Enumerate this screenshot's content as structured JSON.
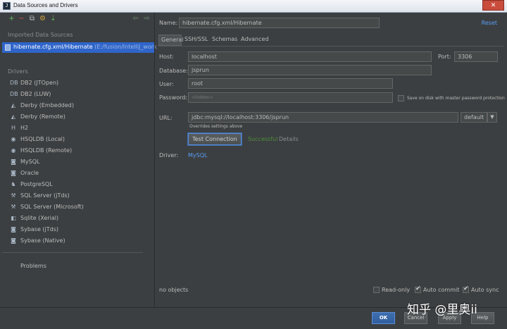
{
  "window": {
    "title": "Data Sources and Drivers",
    "app_icon": "J"
  },
  "left": {
    "toolbar": {
      "add": "+",
      "remove": "−",
      "copy": "⧉",
      "config": "⚙",
      "import": "⇣",
      "back": "⇦",
      "forward": "⇨"
    },
    "imported_header": "Imported Data Sources",
    "selected_source": {
      "name": "hibernate.cfg.xml/Hibernate",
      "path": "(E:/fusion/IntelliJ_work"
    },
    "drivers_header": "Drivers",
    "drivers": [
      {
        "name": "DB2 (JTOpen)",
        "icon": "db2-icon",
        "glyph": "DB"
      },
      {
        "name": "DB2 (LUW)",
        "icon": "db2-icon",
        "glyph": "DB"
      },
      {
        "name": "Derby (Embedded)",
        "icon": "derby-icon",
        "glyph": "◭"
      },
      {
        "name": "Derby (Remote)",
        "icon": "derby-icon",
        "glyph": "◭"
      },
      {
        "name": "H2",
        "icon": "h2-icon",
        "glyph": "H"
      },
      {
        "name": "HSQLDB (Local)",
        "icon": "hsqldb-icon",
        "glyph": "◉"
      },
      {
        "name": "HSQLDB (Remote)",
        "icon": "hsqldb-icon",
        "glyph": "◉"
      },
      {
        "name": "MySQL",
        "icon": "mysql-icon",
        "glyph": "◙"
      },
      {
        "name": "Oracle",
        "icon": "oracle-icon",
        "glyph": "◙"
      },
      {
        "name": "PostgreSQL",
        "icon": "postgresql-icon",
        "glyph": "♞"
      },
      {
        "name": "SQL Server (jTds)",
        "icon": "sqlserver-icon",
        "glyph": "⚒"
      },
      {
        "name": "SQL Server (Microsoft)",
        "icon": "sqlserver-icon",
        "glyph": "⚒"
      },
      {
        "name": "Sqlite (Xerial)",
        "icon": "sqlite-icon",
        "glyph": "◧"
      },
      {
        "name": "Sybase (jTds)",
        "icon": "sybase-icon",
        "glyph": "◙"
      },
      {
        "name": "Sybase (Native)",
        "icon": "sybase-icon",
        "glyph": "◙"
      }
    ],
    "problems": "Problems"
  },
  "form": {
    "name_label": "Name:",
    "name_value": "hibernate.cfg.xml/Hibernate",
    "reset": "Reset",
    "tabs": [
      "General",
      "SSH/SSL",
      "Schemas",
      "Advanced"
    ],
    "host_label": "Host:",
    "host_value": "localhost",
    "port_label": "Port:",
    "port_value": "3306",
    "database_label": "Database:",
    "database_value": "jsprun",
    "user_label": "User:",
    "user_value": "root",
    "password_label": "Password:",
    "password_placeholder": "<hidden>",
    "save_on_disk": "Save on disk with master password protection",
    "url_label": "URL:",
    "url_value": "jdbc:mysql://localhost:3306/jsprun",
    "url_mode": "default",
    "overrides_note": "Overrides settings above",
    "test_connection": "Test Connection",
    "test_status": "Successful",
    "details": "Details",
    "driver_label": "Driver:",
    "driver_value": "MySQL",
    "no_objects": "no objects",
    "read_only": "Read-only",
    "auto_commit": "Auto commit",
    "auto_sync": "Auto sync"
  },
  "buttons": {
    "ok": "OK",
    "cancel": "Cancel",
    "apply": "Apply",
    "help": "Help"
  },
  "watermark": "知乎 @里奥ii",
  "colors": {
    "accent": "#2f65ca",
    "link": "#589df6",
    "success": "#4e8d3c",
    "background": "#3c3f41"
  }
}
